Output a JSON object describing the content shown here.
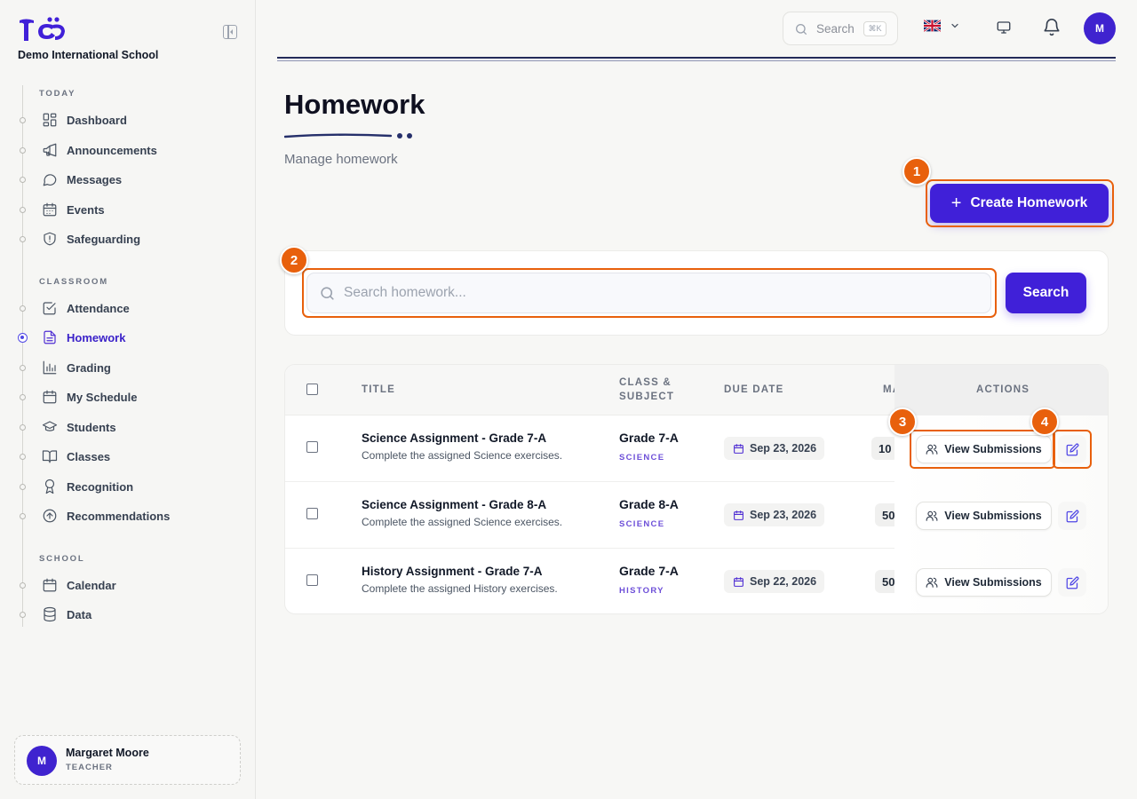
{
  "brand": {
    "name": "Demo International School"
  },
  "colors": {
    "primary": "#4020d8",
    "callout": "#e8600c",
    "subject": "#6d4fd8"
  },
  "sidebar": {
    "sections": [
      {
        "label": "TODAY",
        "items": [
          {
            "label": "Dashboard",
            "icon": "dashboard-icon"
          },
          {
            "label": "Announcements",
            "icon": "megaphone-icon"
          },
          {
            "label": "Messages",
            "icon": "message-icon"
          },
          {
            "label": "Events",
            "icon": "calendar-icon"
          },
          {
            "label": "Safeguarding",
            "icon": "shield-icon"
          }
        ]
      },
      {
        "label": "CLASSROOM",
        "items": [
          {
            "label": "Attendance",
            "icon": "checkbox-icon"
          },
          {
            "label": "Homework",
            "icon": "document-icon",
            "active": true
          },
          {
            "label": "Grading",
            "icon": "bar-chart-icon"
          },
          {
            "label": "My Schedule",
            "icon": "calendar-icon"
          },
          {
            "label": "Students",
            "icon": "graduation-cap-icon"
          },
          {
            "label": "Classes",
            "icon": "book-icon"
          },
          {
            "label": "Recognition",
            "icon": "award-icon"
          },
          {
            "label": "Recommendations",
            "icon": "arrow-up-circle-icon"
          }
        ]
      },
      {
        "label": "SCHOOL",
        "items": [
          {
            "label": "Calendar",
            "icon": "calendar-icon"
          },
          {
            "label": "Data",
            "icon": "database-icon"
          }
        ]
      }
    ]
  },
  "user": {
    "initial": "M",
    "name": "Margaret Moore",
    "role": "TEACHER"
  },
  "topbar": {
    "search_label": "Search",
    "shortcut": "⌘K",
    "avatar_initial": "M"
  },
  "page": {
    "title": "Homework",
    "subtitle": "Manage homework",
    "create_label": "Create Homework",
    "search_placeholder": "Search homework...",
    "search_button": "Search"
  },
  "table": {
    "headers": {
      "title": "TITLE",
      "class_subject_1": "CLASS &",
      "class_subject_2": "SUBJECT",
      "due_date": "DUE DATE",
      "marks": "MA",
      "actions": "ACTIONS"
    },
    "view_label": "View Submissions",
    "rows": [
      {
        "title": "Science Assignment - Grade 7-A",
        "description": "Complete the assigned Science exercises.",
        "class": "Grade 7-A",
        "subject": "SCIENCE",
        "due": "Sep 23, 2026",
        "marks": "10"
      },
      {
        "title": "Science Assignment - Grade 8-A",
        "description": "Complete the assigned Science exercises.",
        "class": "Grade 8-A",
        "subject": "SCIENCE",
        "due": "Sep 23, 2026",
        "marks": "50"
      },
      {
        "title": "History Assignment - Grade 7-A",
        "description": "Complete the assigned History exercises.",
        "class": "Grade 7-A",
        "subject": "HISTORY",
        "due": "Sep 22, 2026",
        "marks": "50"
      }
    ]
  },
  "callouts": [
    "1",
    "2",
    "3",
    "4"
  ]
}
